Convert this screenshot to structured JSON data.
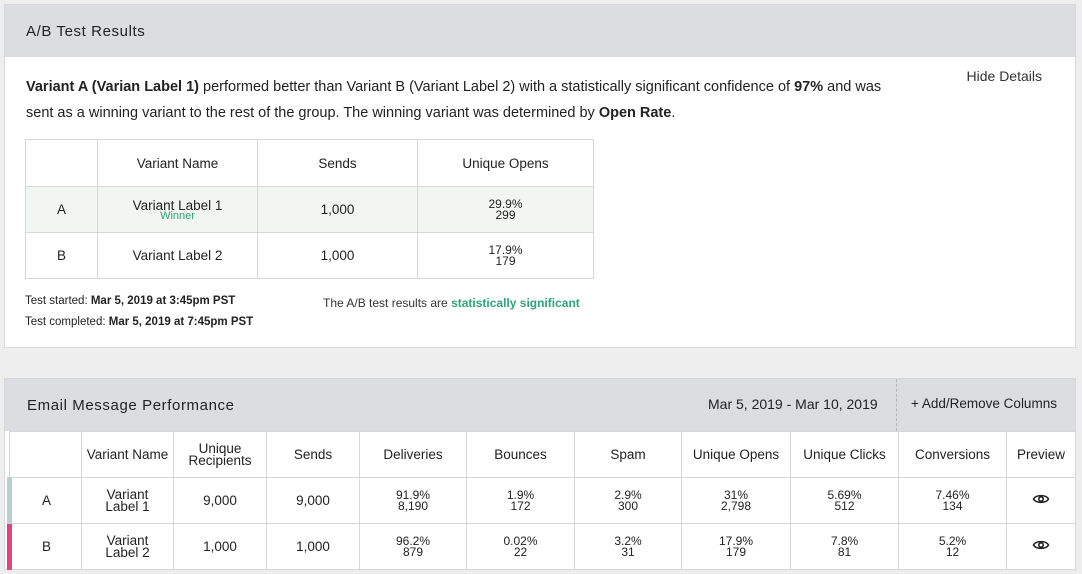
{
  "ab_results": {
    "title": "A/B Test Results",
    "hide_details": "Hide Details",
    "summary": {
      "winner_bold": "Variant A (Varian Label 1)",
      "text1": " performed better than Variant B (Variant Label 2) with a statistically significant confidence of ",
      "confidence": "97%",
      "text2": " and was sent as a winning variant to the rest of the group. The winning variant was determined by ",
      "metric": "Open Rate",
      "text3": "."
    },
    "columns": [
      "",
      "Variant Name",
      "Sends",
      "Unique Opens"
    ],
    "rows": [
      {
        "variant": "A",
        "name": "Variant Label 1",
        "winner": "Winner",
        "sends": "1,000",
        "opens_pct": "29.9%",
        "opens_count": "299"
      },
      {
        "variant": "B",
        "name": "Variant Label 2",
        "sends": "1,000",
        "opens_pct": "17.9%",
        "opens_count": "179"
      }
    ],
    "test_started_label": "Test started: ",
    "test_started_value": "Mar 5, 2019 at 3:45pm PST",
    "test_completed_label": "Test completed: ",
    "test_completed_value": "Mar 5, 2019 at 7:45pm PST",
    "significance_text": "The A/B test results are ",
    "significance_value": "statistically significant"
  },
  "performance": {
    "title": "Email Message Performance",
    "date_range": "Mar 5, 2019 - Mar 10, 2019",
    "add_remove": "+ Add/Remove Columns",
    "columns": [
      "",
      "Variant Name",
      "Unique Recipients",
      "Sends",
      "Deliveries",
      "Bounces",
      "Spam",
      "Unique Opens",
      "Unique Clicks",
      "Conversions",
      "Preview"
    ],
    "column_lines": {
      "recipients_1": "Unique",
      "recipients_2": "Recipients"
    },
    "rows": [
      {
        "variant": "A",
        "name_1": "Variant",
        "name_2": "Label 1",
        "recipients": "9,000",
        "sends": "9,000",
        "deliveries_pct": "91.9%",
        "deliveries": "8,190",
        "bounces_pct": "1.9%",
        "bounces": "172",
        "spam_pct": "2.9%",
        "spam": "300",
        "opens_pct": "31%",
        "opens": "2,798",
        "clicks_pct": "5.69%",
        "clicks": "512",
        "conv_pct": "7.46%",
        "conv": "134",
        "preview_icon": "eye-icon"
      },
      {
        "variant": "B",
        "name_1": "Variant",
        "name_2": "Label 2",
        "recipients": "1,000",
        "sends": "1,000",
        "deliveries_pct": "96.2%",
        "deliveries": "879",
        "bounces_pct": "0.02%",
        "bounces": "22",
        "spam_pct": "3.2%",
        "spam": "31",
        "opens_pct": "17.9%",
        "opens": "179",
        "clicks_pct": "7.8%",
        "clicks": "81",
        "conv_pct": "5.2%",
        "conv": "12",
        "preview_icon": "eye-icon"
      }
    ]
  },
  "colors": {
    "variant_a": "#b9cfd6",
    "variant_b": "#e2437d",
    "success": "#2fa37a",
    "header_bg": "#dcdde0"
  }
}
